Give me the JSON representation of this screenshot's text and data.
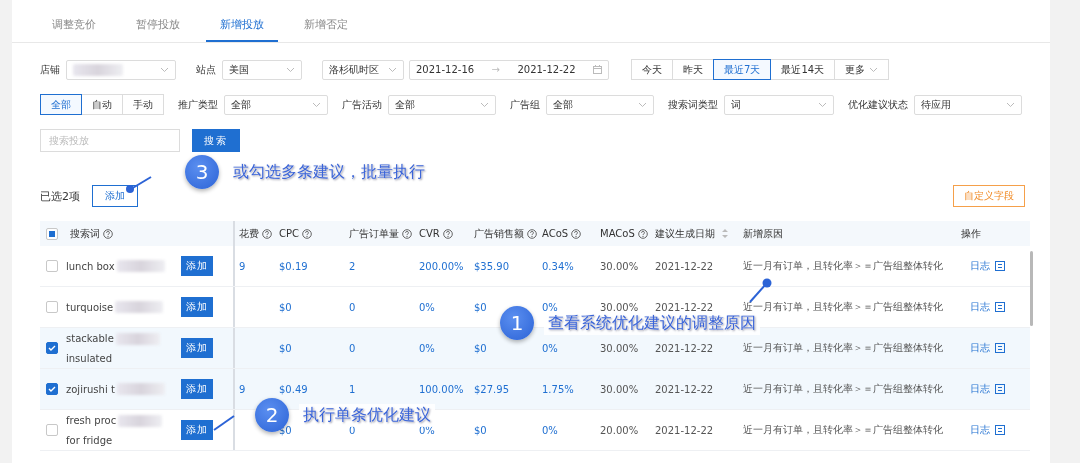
{
  "tabs": [
    {
      "label": "调整竞价",
      "selected": false
    },
    {
      "label": "暂停投放",
      "selected": false
    },
    {
      "label": "新增投放",
      "selected": true
    },
    {
      "label": "新增否定",
      "selected": false
    }
  ],
  "filters": {
    "store": {
      "label": "店铺"
    },
    "site": {
      "label": "站点",
      "value": "美国"
    },
    "timezone": {
      "value": "洛杉矶时区"
    },
    "date_range": {
      "start": "2021-12-16",
      "separator": "→",
      "end": "2021-12-22"
    },
    "quick_dates": [
      {
        "label": "今天",
        "selected": false
      },
      {
        "label": "昨天",
        "selected": false
      },
      {
        "label": "最近7天",
        "selected": true
      },
      {
        "label": "最近14天",
        "selected": false
      }
    ],
    "more": "更多",
    "match_types": [
      {
        "label": "全部",
        "selected": true
      },
      {
        "label": "自动",
        "selected": false
      },
      {
        "label": "手动",
        "selected": false
      }
    ],
    "selects": [
      {
        "label": "推广类型",
        "value": "全部"
      },
      {
        "label": "广告活动",
        "value": "全部"
      },
      {
        "label": "广告组",
        "value": "全部"
      },
      {
        "label": "搜索词类型",
        "value": "词"
      },
      {
        "label": "优化建议状态",
        "value": "待应用"
      }
    ],
    "search": {
      "placeholder": "搜索投放",
      "button": "搜索"
    }
  },
  "toolbar": {
    "selection": "已选2项",
    "batch_button": "添加",
    "custom_fields_button": "自定义字段"
  },
  "table": {
    "select_all_indeterminate": true,
    "columns": [
      {
        "label": "搜索词",
        "help": true
      },
      {
        "label": "花费",
        "help": true
      },
      {
        "label": "CPC",
        "help": true
      },
      {
        "label": "广告订单量",
        "help": true
      },
      {
        "label": "CVR",
        "help": true
      },
      {
        "label": "广告销售额",
        "help": true
      },
      {
        "label": "ACoS",
        "help": true
      },
      {
        "label": "MACoS",
        "help": true
      },
      {
        "label": "建议生成日期",
        "sortable": true
      },
      {
        "label": "新增原因"
      },
      {
        "label": "操作"
      }
    ],
    "rows": [
      {
        "checked": false,
        "term": [
          "lunch box"
        ],
        "add": "添加",
        "spend": "9",
        "values": [
          "$0.19",
          "2",
          "200.00%",
          "$35.90",
          "0.34%",
          "30.00%",
          "2021-12-22",
          "近一月有订单，且转化率＞＝广告组整体转化"
        ],
        "action": "日志"
      },
      {
        "checked": false,
        "term": [
          "turquoise"
        ],
        "add": "添加",
        "values": [
          "$0",
          "0",
          "0%",
          "$0",
          "0%",
          "30.00%",
          "2021-12-22",
          "近一月有订单，且转化率＞＝广告组整体转化"
        ],
        "action": "日志"
      },
      {
        "checked": true,
        "term": [
          "stackable",
          "insulated"
        ],
        "add": "添加",
        "values": [
          "$0",
          "0",
          "0%",
          "$0",
          "0%",
          "30.00%",
          "2021-12-22",
          "近一月有订单，且转化率＞＝广告组整体转化"
        ],
        "action": "日志"
      },
      {
        "checked": true,
        "term": [
          "zojirushi t"
        ],
        "add": "添加",
        "spend": "9",
        "values": [
          "$0.49",
          "1",
          "100.00%",
          "$27.95",
          "1.75%",
          "30.00%",
          "2021-12-22",
          "近一月有订单，且转化率＞＝广告组整体转化"
        ],
        "action": "日志"
      },
      {
        "checked": false,
        "term": [
          "fresh proc",
          "for fridge"
        ],
        "add": "添加",
        "values": [
          "$0",
          "0",
          "0%",
          "$0",
          "0%",
          "20.00%",
          "2021-12-22",
          "近一月有订单，且转化率＞＝广告组整体转化"
        ],
        "action": "日志"
      }
    ]
  },
  "annotations": [
    {
      "number": "3",
      "text": "或勾选多条建议，批量执行"
    },
    {
      "number": "1",
      "text": "查看系统优化建议的调整原因"
    },
    {
      "number": "2",
      "text": "执行单条优化建议"
    }
  ]
}
